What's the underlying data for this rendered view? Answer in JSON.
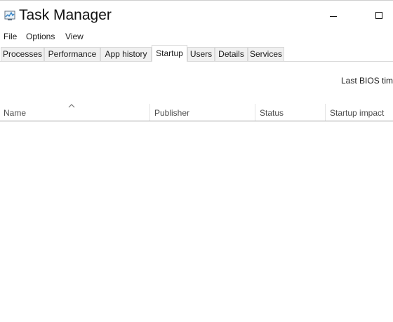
{
  "window": {
    "title": "Task Manager",
    "icon": "task-manager-icon",
    "controls": {
      "minimize_icon": "minimize-icon",
      "maximize_icon": "maximize-icon"
    }
  },
  "menu": {
    "items": [
      {
        "label": "File"
      },
      {
        "label": "Options"
      },
      {
        "label": "View"
      }
    ]
  },
  "tabs": [
    {
      "label": "Processes",
      "active": false
    },
    {
      "label": "Performance",
      "active": false
    },
    {
      "label": "App history",
      "active": false
    },
    {
      "label": "Startup",
      "active": true
    },
    {
      "label": "Users",
      "active": false
    },
    {
      "label": "Details",
      "active": false
    },
    {
      "label": "Services",
      "active": false
    }
  ],
  "startup": {
    "bios_label": "Last BIOS time:",
    "sort_icon": "sort-ascending-icon",
    "columns": [
      {
        "label": "Name"
      },
      {
        "label": "Publisher"
      },
      {
        "label": "Status"
      },
      {
        "label": "Startup impact"
      }
    ],
    "rows": []
  },
  "colors": {
    "tab_background": "#f0f0f0",
    "tab_active_background": "#ffffff",
    "header_text": "#4d4d4d",
    "border": "#d9d9d9"
  }
}
